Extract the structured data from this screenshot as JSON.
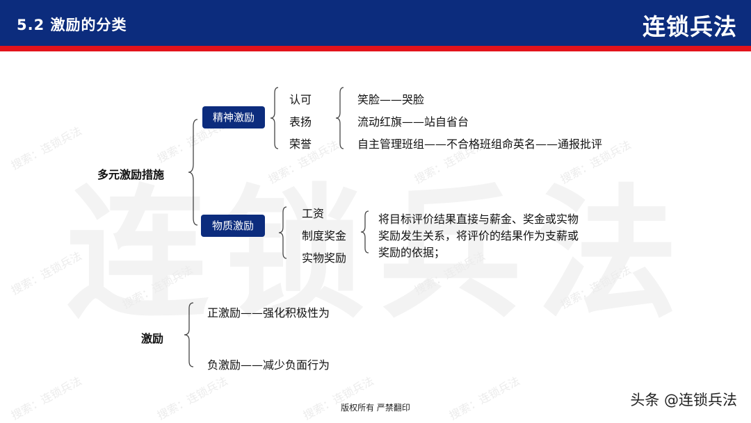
{
  "header": {
    "section_title": "5.2  激励的分类",
    "brand": "连锁兵法"
  },
  "watermark": {
    "big_text": "连锁兵法",
    "small_text": "搜索：连锁兵法"
  },
  "tree1": {
    "root": "多元激励措施",
    "spiritual": {
      "label": "精神激励",
      "items": [
        "认可",
        "表扬",
        "荣誉"
      ],
      "details": [
        "笑脸——哭脸",
        "流动红旗——站自省台",
        "自主管理班组——不合格班组命英名——通报批评"
      ]
    },
    "material": {
      "label": "物质激励",
      "items": [
        "工资",
        "制度奖金",
        "实物奖励"
      ],
      "description": [
        "将目标评价结果直接与薪金、奖金或实物",
        "奖励发生关系，将评价的结果作为支薪或",
        "奖励的依据；"
      ]
    }
  },
  "tree2": {
    "root": "激励",
    "items": [
      "正激励——强化积极性为",
      "负激励——减少负面行为"
    ]
  },
  "footer": {
    "copyright": "版权所有  严禁翻印",
    "source_watermark": "头条 @连锁兵法"
  },
  "colors": {
    "header_blue": "#0c2c7d",
    "accent_red": "#e2131b",
    "pill_blue": "#0c2c7d"
  }
}
